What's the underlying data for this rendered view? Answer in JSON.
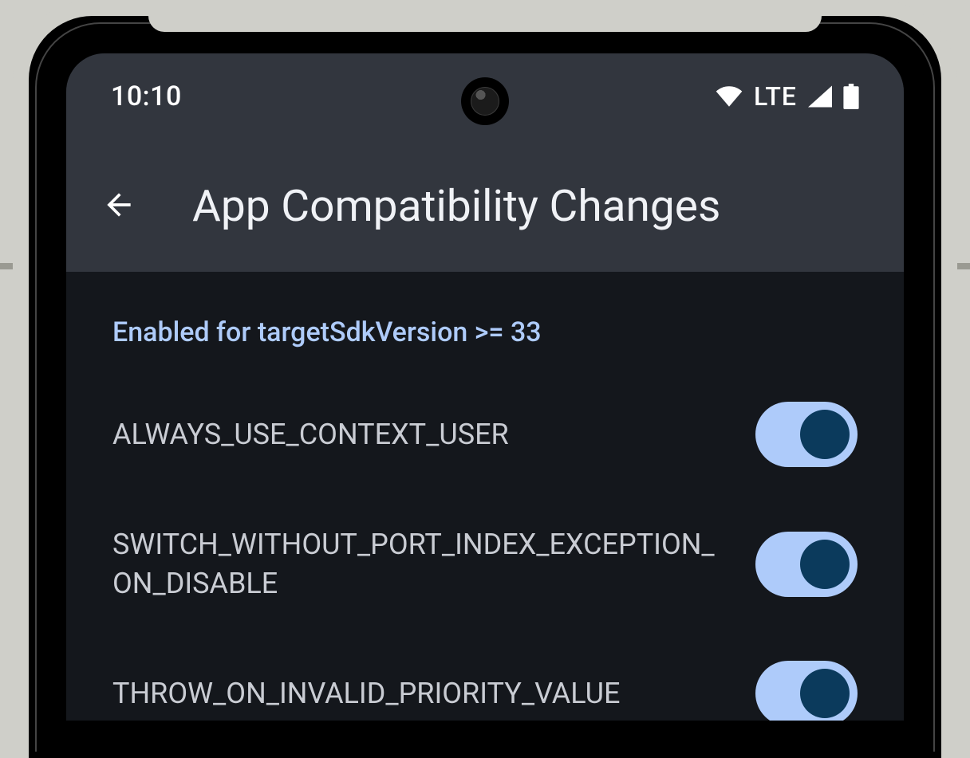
{
  "status": {
    "time": "10:10",
    "network_label": "LTE"
  },
  "header": {
    "title": "App Compatibility Changes"
  },
  "section": {
    "label": "Enabled for targetSdkVersion >= 33"
  },
  "rows": [
    {
      "label": "ALWAYS_USE_CONTEXT_USER",
      "enabled": true
    },
    {
      "label": "SWITCH_WITHOUT_PORT_INDEX_EXCEPTION_ON_DISABLE",
      "enabled": true
    },
    {
      "label": "THROW_ON_INVALID_PRIORITY_VALUE",
      "enabled": true
    }
  ]
}
